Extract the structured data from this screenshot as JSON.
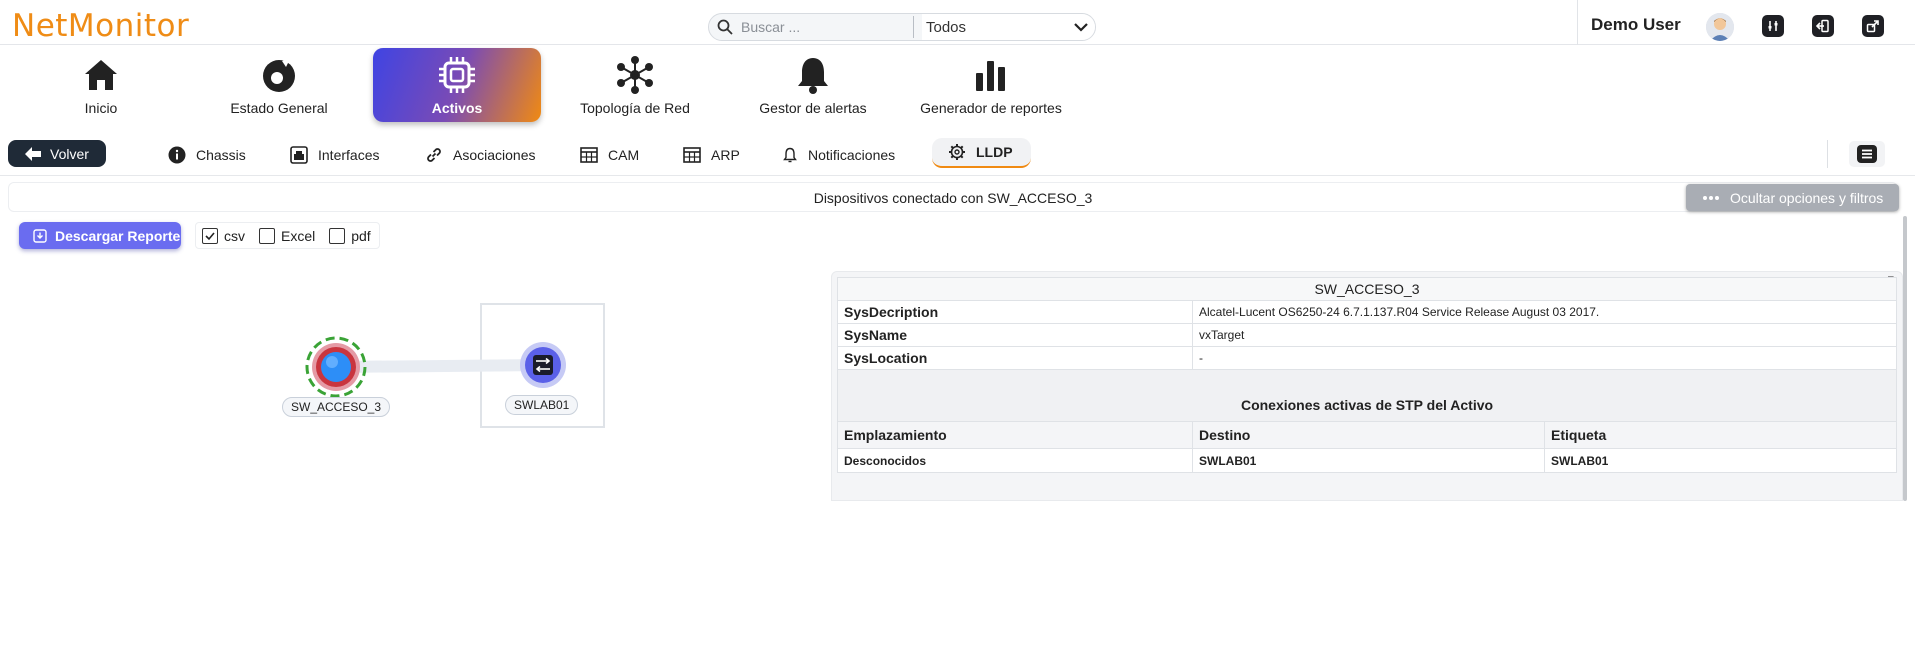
{
  "header": {
    "logo": "NetMonitor",
    "search_placeholder": "Buscar ...",
    "search_scope": "Todos",
    "user_name": "Demo User"
  },
  "modules": [
    {
      "label": "Inicio",
      "icon": "home-icon"
    },
    {
      "label": "Estado General",
      "icon": "gauge-icon"
    },
    {
      "label": "Activos",
      "icon": "chip-icon",
      "active": true
    },
    {
      "label": "Topología de Red",
      "icon": "topology-icon"
    },
    {
      "label": "Gestor de alertas",
      "icon": "bell-icon"
    },
    {
      "label": "Generador de reportes",
      "icon": "bar-chart-icon"
    }
  ],
  "subtabs": {
    "back_label": "Volver",
    "items": [
      {
        "label": "Chassis",
        "icon": "info-icon"
      },
      {
        "label": "Interfaces",
        "icon": "interfaces-icon"
      },
      {
        "label": "Asociaciones",
        "icon": "link-icon"
      },
      {
        "label": "CAM",
        "icon": "table-icon"
      },
      {
        "label": "ARP",
        "icon": "table-icon"
      },
      {
        "label": "Notificaciones",
        "icon": "bell-icon"
      },
      {
        "label": "LLDP",
        "icon": "gear-icon",
        "active": true
      }
    ]
  },
  "content": {
    "title": "Dispositivos conectado con SW_ACCESO_3",
    "filter_button": "Ocultar opciones y filtros",
    "download_button": "Descargar Reporte",
    "formats": [
      {
        "label": "csv",
        "checked": true
      },
      {
        "label": "Excel",
        "checked": false
      },
      {
        "label": "pdf",
        "checked": false
      }
    ]
  },
  "graph": {
    "nodes": [
      {
        "label": "SW_ACCESO_3"
      },
      {
        "label": "SWLAB01"
      }
    ]
  },
  "panel": {
    "device": "SW_ACCESO_3",
    "fields": [
      {
        "label": "SysDecription",
        "value": "Alcatel-Lucent OS6250-24 6.7.1.137.R04 Service Release August 03 2017."
      },
      {
        "label": "SysName",
        "value": "vxTarget"
      },
      {
        "label": "SysLocation",
        "value": "-"
      }
    ],
    "stp_title": "Conexiones activas de STP del Activo",
    "columns": [
      "Emplazamiento",
      "Destino",
      "Etiqueta"
    ],
    "rows": [
      [
        "Desconocidos",
        "SWLAB01",
        "SWLAB01"
      ]
    ]
  },
  "colors": {
    "brand_orange": "#ef8c16",
    "active_gradient_start": "#3f44e3",
    "download_button": "#6a6cf0",
    "dark_button": "#1f2a37"
  }
}
